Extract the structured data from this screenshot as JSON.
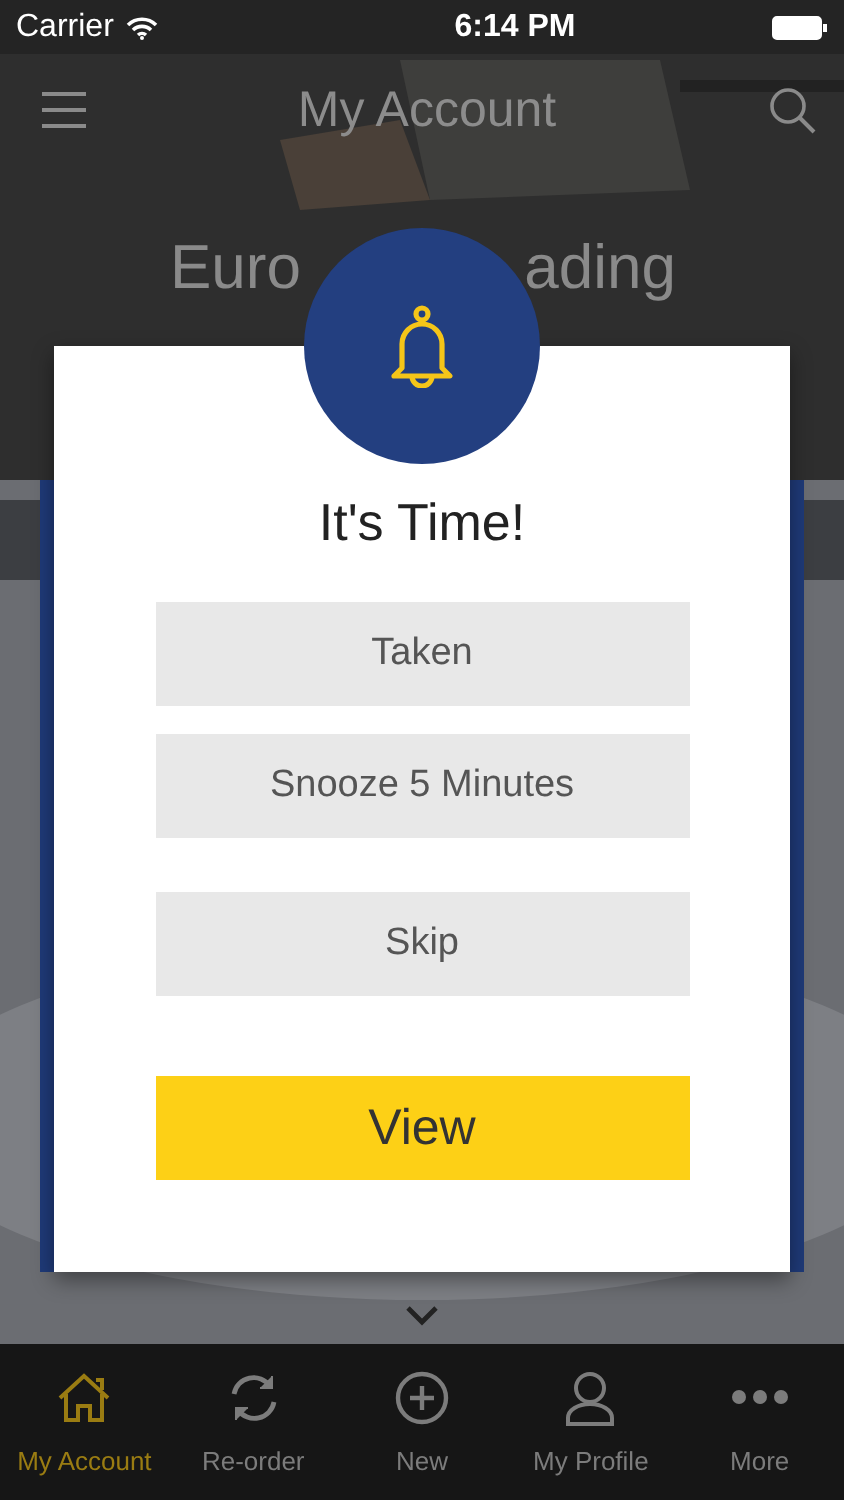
{
  "status_bar": {
    "carrier": "Carrier",
    "time": "6:14 PM"
  },
  "nav": {
    "title": "My Account"
  },
  "hero": {
    "fragments": [
      "Euro",
      "ading"
    ]
  },
  "dialog": {
    "title": "It's Time!",
    "actions": [
      {
        "label": "Taken",
        "kind": "plain"
      },
      {
        "label": "Snooze 5 Minutes",
        "kind": "plain"
      },
      {
        "label": "Skip",
        "kind": "plain"
      },
      {
        "label": "View",
        "kind": "primary"
      }
    ]
  },
  "tabs": [
    {
      "label": "My Account",
      "selected": true
    },
    {
      "label": "Re-order",
      "selected": false
    },
    {
      "label": "New",
      "selected": false
    },
    {
      "label": "My Profile",
      "selected": false
    },
    {
      "label": "More",
      "selected": false
    }
  ]
}
